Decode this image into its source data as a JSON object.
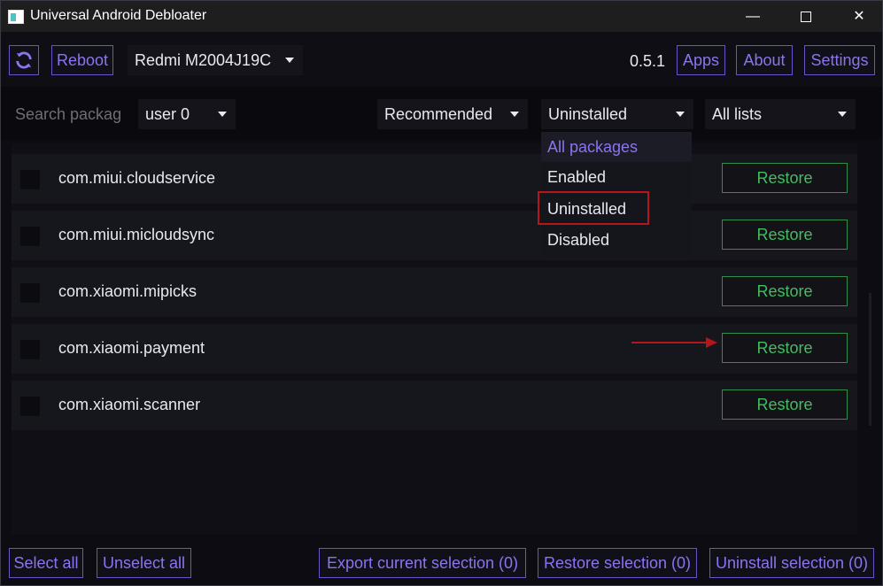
{
  "window": {
    "title": "Universal Android Debloater",
    "controls": [
      "—",
      "☐",
      "✕"
    ]
  },
  "toolbar": {
    "refresh_icon": "refresh-icon",
    "reboot_label": "Reboot",
    "device": "Redmi M2004J19C",
    "version": "0.5.1",
    "apps_label": "Apps",
    "about_label": "About",
    "settings_label": "Settings"
  },
  "filters": {
    "search_placeholder": "Search packages",
    "user": "user 0",
    "recommendation": "Recommended",
    "state": "Uninstalled",
    "lists": "All lists"
  },
  "dropdown": {
    "options": [
      "All packages",
      "Enabled",
      "Uninstalled",
      "Disabled"
    ],
    "highlighted": "Uninstalled"
  },
  "packages": [
    {
      "name": "com.miui.cloudservice",
      "action": "Restore"
    },
    {
      "name": "com.miui.micloudsync",
      "action": "Restore"
    },
    {
      "name": "com.xiaomi.mipicks",
      "action": "Restore"
    },
    {
      "name": "com.xiaomi.payment",
      "action": "Restore"
    },
    {
      "name": "com.xiaomi.scanner",
      "action": "Restore"
    }
  ],
  "bottom": {
    "select_all": "Select all",
    "unselect_all": "Unselect all",
    "export": "Export current selection (0)",
    "restore": "Restore selection (0)",
    "uninstall": "Uninstall selection (0)"
  },
  "colors": {
    "accent": "#8c73f0",
    "restore_green": "#3fbf5e",
    "annotation_red": "#b5161c",
    "background": "#0c0c12"
  }
}
